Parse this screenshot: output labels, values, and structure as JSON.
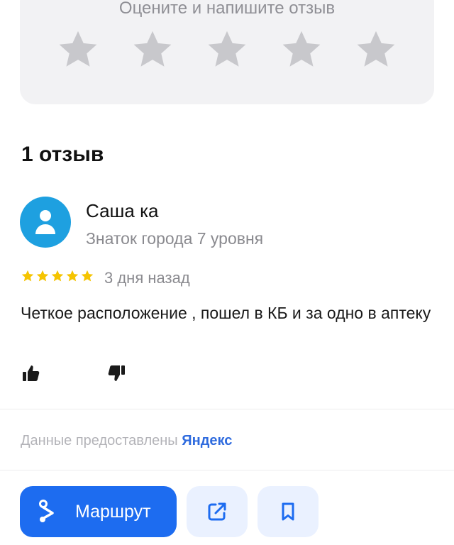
{
  "rating_prompt": {
    "text": "Оцените и напишите отзыв",
    "stars": 5,
    "star_color": "#c8c8cc"
  },
  "reviews": {
    "count_label": "1 отзыв",
    "items": [
      {
        "author": "Саша ка",
        "level": "Знаток города 7 уровня",
        "rating": 5,
        "date": "3 дня назад",
        "text": "Четкое расположение , пошел в КБ и за одно в аптеку",
        "avatar_color": "#1ea0e0",
        "star_color": "#f5c400"
      }
    ]
  },
  "attribution": {
    "prefix": "Данные предоставлены",
    "brand": "Яндекс",
    "brand_color": "#2f6bde"
  },
  "actions": {
    "route_label": "Маршрут",
    "primary_color": "#1d6cf0",
    "share_icon": "share-icon",
    "bookmark_icon": "bookmark-icon"
  }
}
